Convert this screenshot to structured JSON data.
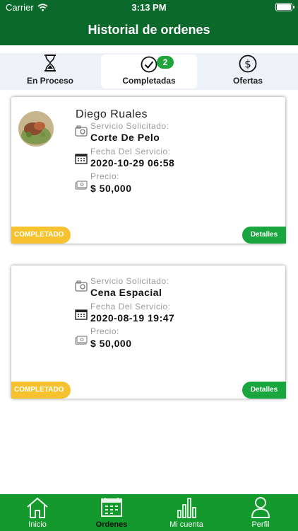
{
  "status_bar": {
    "carrier": "Carrier",
    "time": "3:13 PM"
  },
  "header": {
    "title": "Historial de ordenes"
  },
  "tabs": [
    {
      "label": "En Proceso",
      "icon": "hourglass-icon"
    },
    {
      "label": "Completadas",
      "icon": "check-circle-icon",
      "badge": "2",
      "active": true
    },
    {
      "label": "Ofertas",
      "icon": "dollar-circle-icon"
    }
  ],
  "orders": [
    {
      "name": "Diego Ruales",
      "service_label": "Servicio Solicitado:",
      "service": "Corte De Pelo",
      "date_label": "Fecha Del Servicio:",
      "date": "2020-10-29 06:58",
      "price_label": "Precio:",
      "price": "$ 50,000",
      "status": "COMPLETADO",
      "details": "Detalles"
    },
    {
      "service_label": "Servicio Solicitado:",
      "service": "Cena Espacial",
      "date_label": "Fecha Del Servicio:",
      "date": "2020-08-19 19:47",
      "price_label": "Precio:",
      "price": "$ 50,000",
      "status": "COMPLETADO",
      "details": "Detalles"
    }
  ],
  "bottom_nav": [
    {
      "label": "Inicio",
      "icon": "home-icon"
    },
    {
      "label": "Ordenes",
      "icon": "calendar-icon",
      "active": true
    },
    {
      "label": "Mi cuenta",
      "icon": "bar-chart-icon"
    },
    {
      "label": "Perfil",
      "icon": "user-icon"
    }
  ],
  "colors": {
    "header": "#0b6a2b",
    "nav": "#149a2c",
    "status_pill": "#f6c230",
    "details_pill": "#1aa63e",
    "badge": "#1fa53a"
  }
}
